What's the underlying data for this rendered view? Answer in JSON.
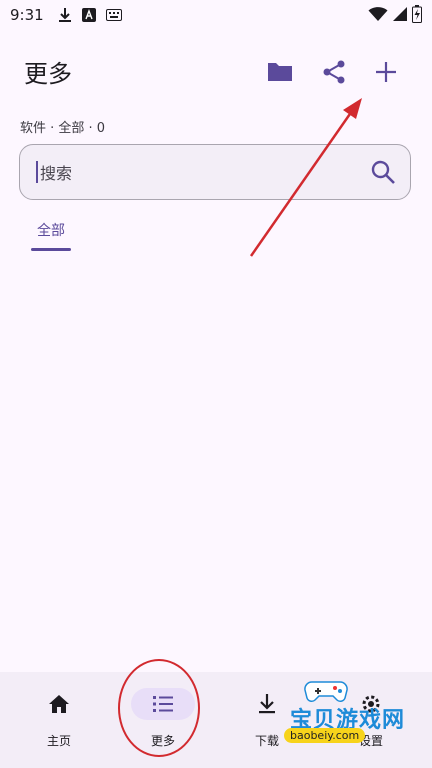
{
  "status_bar": {
    "time": "9:31",
    "left_icons": [
      "download-icon",
      "font-a-icon",
      "keyboard-icon"
    ],
    "right_icons": [
      "wifi-icon",
      "signal-icon",
      "battery-charging-icon"
    ]
  },
  "header": {
    "title": "更多",
    "actions": [
      "folder-icon",
      "share-icon",
      "add-icon"
    ]
  },
  "subtitle": "软件 · 全部 · 0",
  "search": {
    "placeholder": "搜索"
  },
  "tabs": [
    {
      "label": "全部",
      "selected": true
    }
  ],
  "bottom_nav": {
    "items": [
      {
        "label": "主页",
        "icon": "home-icon"
      },
      {
        "label": "更多",
        "icon": "list-icon",
        "active": true
      },
      {
        "label": "下载",
        "icon": "download-icon"
      },
      {
        "label": "设置",
        "icon": "settings-icon"
      }
    ]
  },
  "watermark": {
    "logo": "宝贝游戏网",
    "site": "baobeiy.com"
  },
  "colors": {
    "background": "#fdf7ff",
    "accent": "#5b4a9b",
    "nav_background": "#f3edf7",
    "nav_active_pill": "#e8def8",
    "annotation_red": "#d22a2f"
  }
}
